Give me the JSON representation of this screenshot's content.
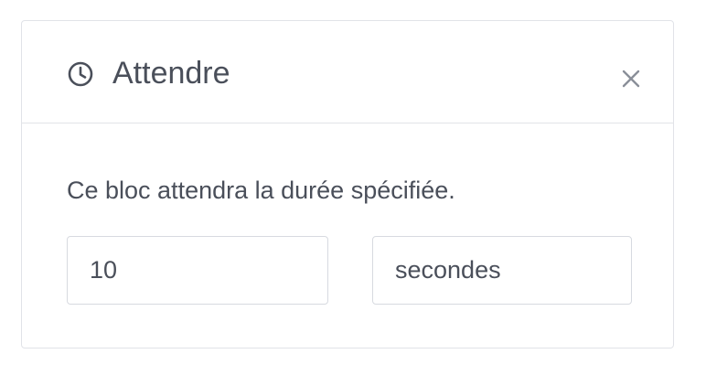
{
  "dialog": {
    "title": "Attendre",
    "icon": "clock-icon",
    "close_icon": "close-icon",
    "description": "Ce bloc attendra la durée spécifiée.",
    "duration": {
      "value": "10"
    },
    "unit": {
      "selected": "secondes"
    }
  },
  "colors": {
    "text": "#4a4f5a",
    "border": "#e1e3e8",
    "icon": "#8a8f99"
  }
}
